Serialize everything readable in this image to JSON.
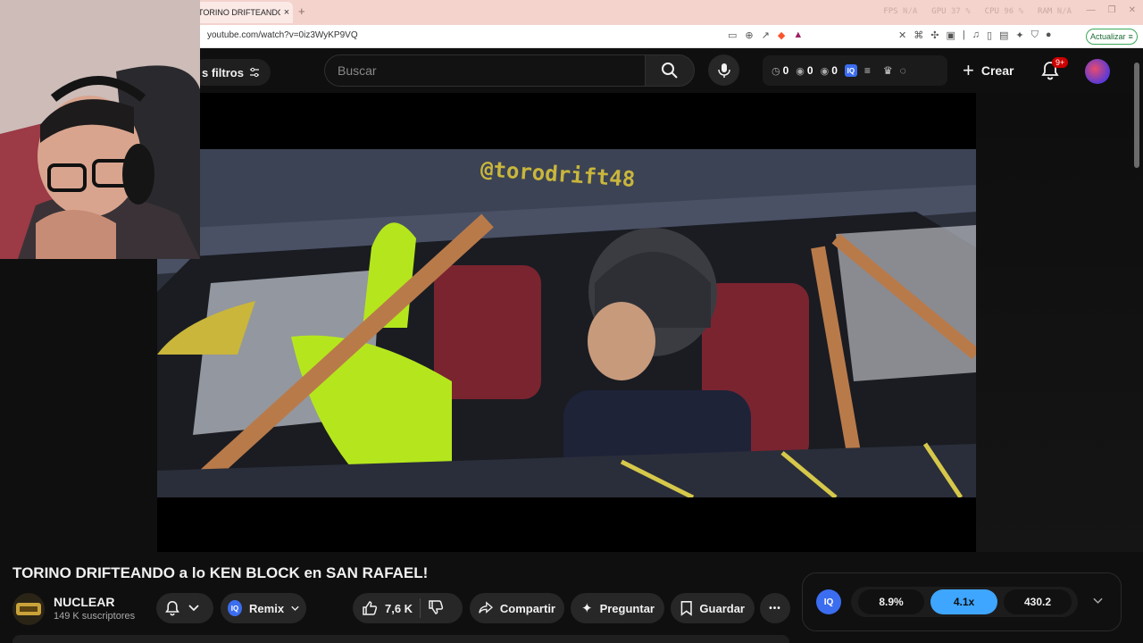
{
  "browser": {
    "tab_title": "TORINO DRIFTEANDO a l",
    "tab_close": "×",
    "new_tab": "+",
    "url": "youtube.com/watch?v=0iz3WyKP9VQ",
    "update_label": "Actualizar",
    "stats": [
      {
        "label": "FPS",
        "value": "N/A"
      },
      {
        "label": "GPU",
        "value": "37 %"
      },
      {
        "label": "CPU",
        "value": "96 %"
      },
      {
        "label": "RAM",
        "value": "N/A"
      }
    ]
  },
  "header": {
    "filters_label": "s filtros",
    "search_placeholder": "Buscar",
    "counters": [
      "0",
      "0",
      "0"
    ],
    "iq_label": "IQ",
    "create_label": "Crear",
    "notif_badge": "9+"
  },
  "video": {
    "title": "TORINO DRIFTEANDO a lo KEN BLOCK en SAN RAFAEL!",
    "overlay_text": "@torodrift48"
  },
  "channel": {
    "name": "NUCLEAR",
    "subscribers": "149 K suscriptores"
  },
  "actions": {
    "remix_label": "Remix",
    "likes": "7,6 K",
    "share_label": "Compartir",
    "ask_label": "Preguntar",
    "save_label": "Guardar",
    "more_label": "•••"
  },
  "iq_panel": {
    "logo": "IQ",
    "stat1": "8.9%",
    "stat2": "4.1x",
    "stat3": "430.2"
  },
  "colors": {
    "accent_blue": "#3ea6ff",
    "iq_blue": "#3b6df0",
    "notif_red": "#cc0000"
  }
}
